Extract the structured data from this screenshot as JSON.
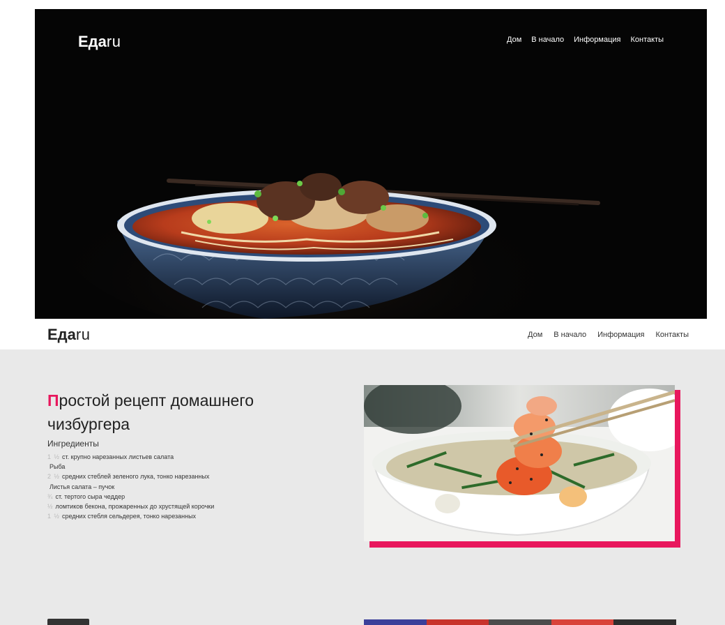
{
  "brand": {
    "bold": "Еда",
    "light": "ru"
  },
  "hero": {
    "nav": [
      "Дом",
      "В начало",
      "Информация",
      "Контакты"
    ]
  },
  "navbar": {
    "links": [
      "Дом",
      "В начало",
      "Информация",
      "Контакты"
    ]
  },
  "recipe": {
    "title_first_letter": "П",
    "title_rest": "ростой рецепт домашнего чизбургера",
    "ingredients_heading": "Ингредиенты",
    "ingredients": [
      {
        "qty": "1 ½",
        "text": "ст. крупно нарезанных листьев салата"
      },
      {
        "qty": "",
        "text": "Рыба"
      },
      {
        "qty": "2 ½",
        "text": "средних стеблей зеленого лука, тонко нарезанных"
      },
      {
        "qty": "",
        "text": "Листья салата – пучок"
      },
      {
        "qty": "¾",
        "text": "ст. тертого сыра чеддер"
      },
      {
        "qty": "½",
        "text": "ломтиков бекона, прожаренных до хрустящей корочки"
      },
      {
        "qty": "1 ½",
        "text": "средних стебля сельдерея, тонко нарезанных"
      }
    ]
  },
  "colors": {
    "accent": "#e8175d",
    "hero_bg": "#050505",
    "section_bg": "#e9e9e9"
  }
}
